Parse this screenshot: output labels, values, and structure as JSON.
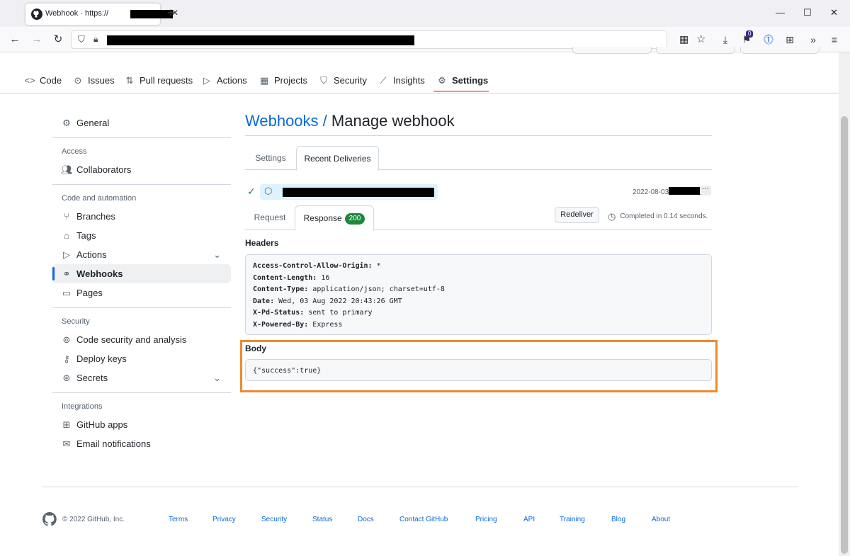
{
  "browser": {
    "tab_title": "Webhook · https://",
    "close_glyph": "✕",
    "new_tab_glyph": "+",
    "minimize_glyph": "—",
    "maximize_glyph": "☐",
    "window_close_glyph": "✕",
    "extension_badge": "0"
  },
  "repo_nav": [
    {
      "label": "Code",
      "icon": "code-icon",
      "glyph": "<>"
    },
    {
      "label": "Issues",
      "icon": "issue-icon",
      "glyph": "⊙"
    },
    {
      "label": "Pull requests",
      "icon": "pull-request-icon",
      "glyph": "⇅"
    },
    {
      "label": "Actions",
      "icon": "play-icon",
      "glyph": "▷"
    },
    {
      "label": "Projects",
      "icon": "table-icon",
      "glyph": "▦"
    },
    {
      "label": "Security",
      "icon": "shield-icon",
      "glyph": "⛉"
    },
    {
      "label": "Insights",
      "icon": "graph-icon",
      "glyph": "⟋"
    },
    {
      "label": "Settings",
      "icon": "gear-icon",
      "glyph": "⚙"
    }
  ],
  "sidebar": {
    "general": "General",
    "groups": {
      "access": "Access",
      "code_automation": "Code and automation",
      "security": "Security",
      "integrations": "Integrations"
    },
    "items": {
      "collaborators": "Collaborators",
      "branches": "Branches",
      "tags": "Tags",
      "actions": "Actions",
      "webhooks": "Webhooks",
      "pages": "Pages",
      "code_security": "Code security and analysis",
      "deploy_keys": "Deploy keys",
      "secrets": "Secrets",
      "github_apps": "GitHub apps",
      "email_notifications": "Email notifications"
    }
  },
  "main": {
    "breadcrumb_link": "Webhooks",
    "breadcrumb_sep": " / ",
    "title": "Manage webhook",
    "tabs": {
      "settings": "Settings",
      "recent_deliveries": "Recent Deliveries"
    },
    "delivery": {
      "time_prefix": "2022-08-03",
      "more": "···"
    },
    "req_tabs": {
      "request": "Request",
      "response": "Response",
      "status_code": "200"
    },
    "redeliver": "Redeliver",
    "completed": "Completed in 0.14 seconds.",
    "headers_title": "Headers",
    "headers": [
      {
        "key": "Access-Control-Allow-Origin:",
        "value": " *"
      },
      {
        "key": "Content-Length:",
        "value": " 16"
      },
      {
        "key": "Content-Type:",
        "value": " application/json; charset=utf-8"
      },
      {
        "key": "Date:",
        "value": " Wed, 03 Aug 2022 20:43:26 GMT"
      },
      {
        "key": "X-Pd-Status:",
        "value": " sent to primary"
      },
      {
        "key": "X-Powered-By:",
        "value": " Express"
      }
    ],
    "body_title": "Body",
    "body": "{\"success\":true}"
  },
  "footer": {
    "copyright": "© 2022 GitHub, Inc.",
    "links": [
      "Terms",
      "Privacy",
      "Security",
      "Status",
      "Docs",
      "Contact GitHub",
      "Pricing",
      "API",
      "Training",
      "Blog",
      "About"
    ]
  },
  "colors": {
    "accent": "#0969da",
    "success": "#1f883d",
    "highlight": "#f0892d",
    "tab_underline": "#fd8c73"
  }
}
